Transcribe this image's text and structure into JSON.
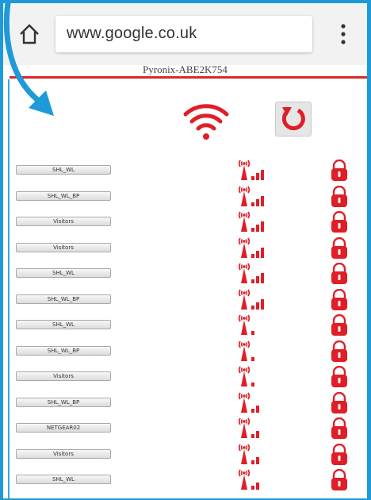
{
  "browser": {
    "url": "www.google.co.uk",
    "home_icon": "home-icon",
    "menu_icon": "overflow-menu-icon"
  },
  "device_name": "Pyronix-ABE2K754",
  "colors": {
    "accent_red": "#e01e28",
    "frame_blue": "#1e9ad8",
    "divider_red": "#d62a2a"
  },
  "header_icons": {
    "wifi": "wifi-icon",
    "refresh": "refresh-icon"
  },
  "networks": [
    {
      "ssid": "SHL_WL",
      "signal_bars": 3,
      "secured": true
    },
    {
      "ssid": "SHL_WL_BP",
      "signal_bars": 3,
      "secured": true
    },
    {
      "ssid": "Visitors",
      "signal_bars": 3,
      "secured": true
    },
    {
      "ssid": "Visitors",
      "signal_bars": 3,
      "secured": true
    },
    {
      "ssid": "SHL_WL",
      "signal_bars": 3,
      "secured": true
    },
    {
      "ssid": "SHL_WL_BP",
      "signal_bars": 3,
      "secured": true
    },
    {
      "ssid": "SHL_WL",
      "signal_bars": 1,
      "secured": true
    },
    {
      "ssid": "SHL_WL_BP",
      "signal_bars": 1,
      "secured": true
    },
    {
      "ssid": "Visitors",
      "signal_bars": 1,
      "secured": true
    },
    {
      "ssid": "SHL_WL_BP",
      "signal_bars": 2,
      "secured": true
    },
    {
      "ssid": "NETGEAR02",
      "signal_bars": 2,
      "secured": true
    },
    {
      "ssid": "Visitors",
      "signal_bars": 2,
      "secured": true
    },
    {
      "ssid": "SHL_WL",
      "signal_bars": 2,
      "secured": true
    }
  ]
}
